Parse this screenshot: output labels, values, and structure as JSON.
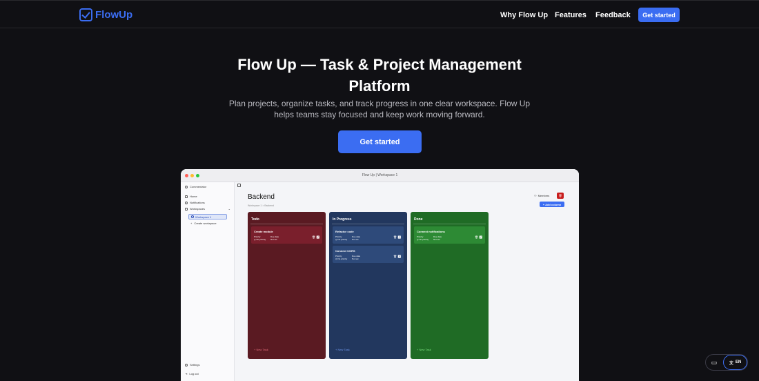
{
  "nav": {
    "brand": "FlowUp",
    "links": [
      "Why Flow Up",
      "Features",
      "Feedback"
    ],
    "cta": "Get started"
  },
  "hero": {
    "title_line1": "Flow Up — Task & Project Management",
    "title_line2": "Platform",
    "subtitle_line1": "Plan projects, organize tasks, and track progress in one clear workspace. Flow Up",
    "subtitle_line2": "helps teams stay focused and keep work moving forward.",
    "cta": "Get started"
  },
  "preview": {
    "window_title": "Flow Up | Workspace 1",
    "sidebar": {
      "user": "Commentator",
      "home": "Home",
      "notifications": "Notifications",
      "workspaces": "Workspaces",
      "active_workspace": "Workspace 1",
      "create_workspace": "Create workspace",
      "settings": "Settings",
      "logout": "Log out"
    },
    "board_title": "Backend",
    "breadcrumb": "Workspace 1  >  Backend",
    "members_label": "Members",
    "add_column": "+ Add column",
    "columns": [
      {
        "title": "Todo",
        "color": "#5a1a22",
        "card_color": "#7a1f2c",
        "new_task": "+ New Task",
        "new_task_color": "#e36b7a",
        "cards": [
          {
            "title": "Create module",
            "priority_label": "Priority",
            "priority": "No priority",
            "due_label": "Due date",
            "due": "Not set"
          }
        ]
      },
      {
        "title": "In Progress",
        "color": "#22375e",
        "card_color": "#2e4a7a",
        "new_task": "+ New Task",
        "new_task_color": "#6c93e8",
        "cards": [
          {
            "title": "Refactor code",
            "priority_label": "Priority",
            "priority": "No priority",
            "due_label": "Due date",
            "due": "Not set"
          },
          {
            "title": "Connect CORS",
            "priority_label": "Priority",
            "priority": "No priority",
            "due_label": "Due date",
            "due": "Not set"
          }
        ]
      },
      {
        "title": "Done",
        "color": "#1f6b25",
        "card_color": "#2d8a34",
        "new_task": "+ New Task",
        "new_task_color": "#7ae07f",
        "cards": [
          {
            "title": "Connect notifications",
            "priority_label": "Priority",
            "priority": "No priority",
            "due_label": "Due date",
            "due": "Not set"
          }
        ]
      }
    ]
  },
  "language": "EN",
  "accent_color": "#3b6df2"
}
